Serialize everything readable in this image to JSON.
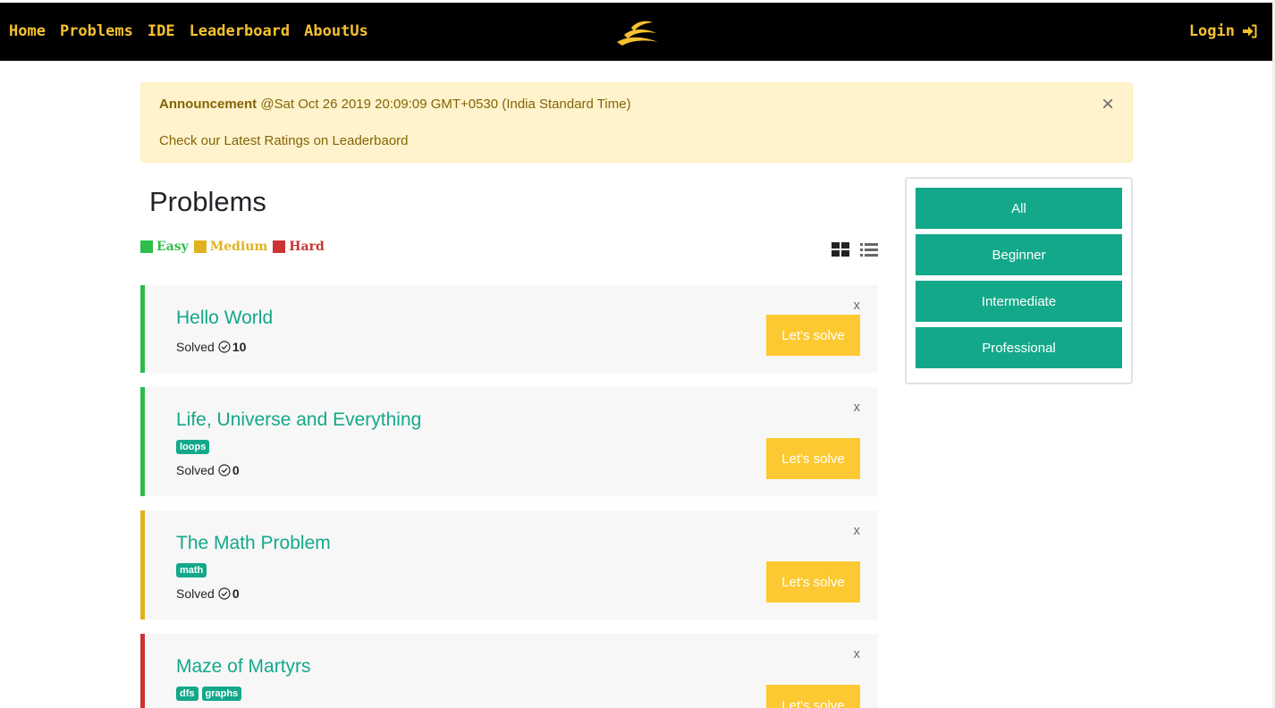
{
  "nav": {
    "links": [
      "Home",
      "Problems",
      "IDE",
      "Leaderboard",
      "AboutUs"
    ],
    "login_label": "Login",
    "accent_color": "#f6c12f",
    "logo_icon": "swoosh-logo",
    "login_icon": "sign-in-icon"
  },
  "announcement": {
    "label": "Announcement",
    "timestamp": "@Sat Oct 26 2019 20:09:09 GMT+0530 (India Standard Time)",
    "message": "Check our Latest Ratings on Leaderbaord",
    "close_symbol": "×"
  },
  "page_title": "Problems",
  "difficulty_legend": [
    {
      "label": "Easy",
      "color": "#2ebd4a"
    },
    {
      "label": "Medium",
      "color": "#e0b21f"
    },
    {
      "label": "Hard",
      "color": "#cc3333"
    }
  ],
  "view_toggles": [
    "grid-view-icon",
    "list-view-icon"
  ],
  "problems": [
    {
      "title": "Hello World",
      "difficulty": "Easy",
      "tags": [],
      "solved_label": "Solved",
      "solved_count": "10",
      "button": "Let's solve",
      "close": "x"
    },
    {
      "title": "Life, Universe and Everything",
      "difficulty": "Easy",
      "tags": [
        "loops"
      ],
      "solved_label": "Solved",
      "solved_count": "0",
      "button": "Let's solve",
      "close": "x"
    },
    {
      "title": "The Math Problem",
      "difficulty": "Medium",
      "tags": [
        "math"
      ],
      "solved_label": "Solved",
      "solved_count": "0",
      "button": "Let's solve",
      "close": "x"
    },
    {
      "title": "Maze of Martyrs",
      "difficulty": "Hard",
      "tags": [
        "dfs",
        "graphs"
      ],
      "solved_label": "",
      "solved_count": "",
      "button": "Let's solve",
      "close": "x"
    }
  ],
  "levels": [
    "All",
    "Beginner",
    "Intermediate",
    "Professional"
  ],
  "colors": {
    "teal": "#14a88a",
    "yellow_button": "#fcc932",
    "card_bg": "#f7f7f7",
    "alert_bg": "#fff3cd",
    "alert_text": "#856404"
  }
}
